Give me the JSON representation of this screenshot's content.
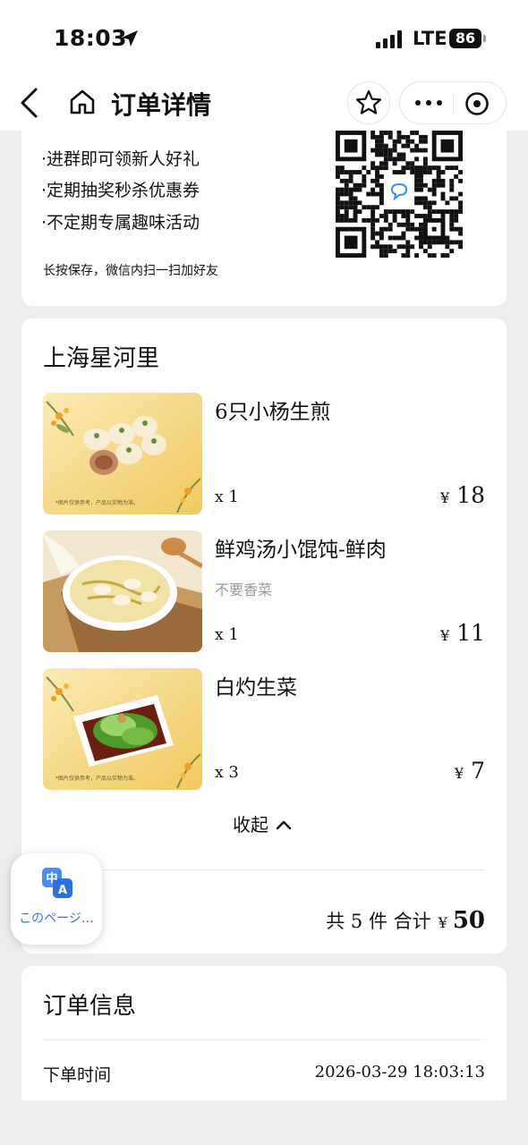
{
  "status_bar": {
    "time": "18:03",
    "network": "LTE",
    "battery": "86"
  },
  "nav": {
    "title": "订单详情"
  },
  "promo": {
    "lines": [
      "·进群即可领新人好礼",
      "·定期抽奖秒杀优惠券",
      "·不定期专属趣味活动"
    ],
    "note": "长按保存，微信内扫一扫加好友"
  },
  "order": {
    "store": "上海星河里",
    "items": [
      {
        "name": "6只小杨生煎",
        "note": "",
        "qty_prefix": "x",
        "qty": "1",
        "currency": "¥",
        "price": "18"
      },
      {
        "name": "鲜鸡汤小馄饨-鲜肉",
        "note": "不要香菜",
        "qty_prefix": "x",
        "qty": "1",
        "currency": "¥",
        "price": "11"
      },
      {
        "name": "白灼生菜",
        "note": "",
        "qty_prefix": "x",
        "qty": "3",
        "currency": "¥",
        "price": "7"
      }
    ],
    "image_disclaimer": "*图片仅供参考，产品以实物为准。",
    "collapse_label": "收起",
    "total": {
      "count_label": "共 5 件 合计",
      "currency": "¥",
      "amount": "50"
    }
  },
  "order_info": {
    "title": "订单信息",
    "rows": [
      {
        "label": "下单时间",
        "value": "2026-03-29 18:03:13"
      }
    ]
  },
  "translate_button": {
    "label": "このページ…",
    "icon_glyph_1": "中",
    "icon_glyph_2": "A"
  },
  "colors": {
    "accent_blue": "#3a6fd8",
    "background": "#ededed",
    "muted_text": "#999999"
  }
}
